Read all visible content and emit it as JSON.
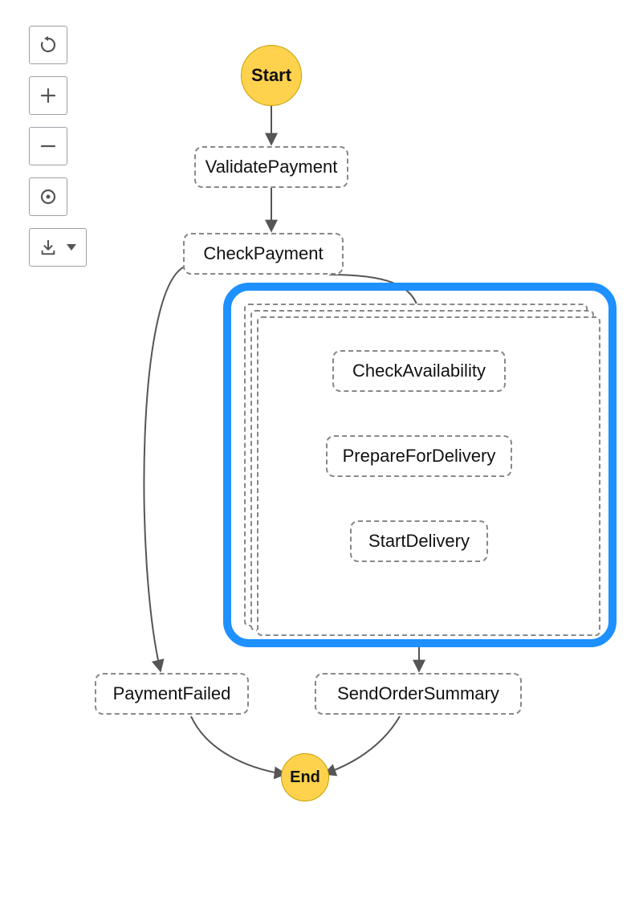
{
  "toolbar": {
    "reset_icon": "reset",
    "zoom_in_icon": "zoom-in",
    "zoom_out_icon": "zoom-out",
    "center_icon": "center",
    "download_icon": "download"
  },
  "colors": {
    "start_end_fill": "#ffd24d",
    "start_end_border": "#c7a100",
    "highlight": "#1e90ff",
    "node_border": "#888888",
    "edge": "#555555"
  },
  "diagram": {
    "start_label": "Start",
    "end_label": "End",
    "nodes": {
      "validate_payment": "ValidatePayment",
      "check_payment": "CheckPayment",
      "payment_failed": "PaymentFailed",
      "send_order_summary": "SendOrderSummary",
      "map": {
        "check_availability": "CheckAvailability",
        "prepare_for_delivery": "PrepareForDelivery",
        "start_delivery": "StartDelivery"
      }
    }
  }
}
